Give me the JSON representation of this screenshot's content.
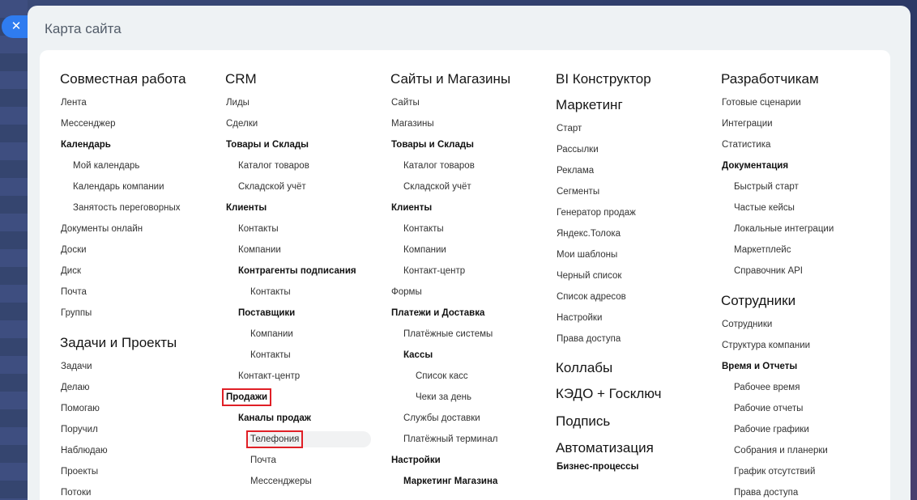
{
  "close_icon": "close-icon",
  "panel": {
    "title": "Карта сайта"
  },
  "columns": {
    "c1": {
      "sec1": "Совместная работа",
      "items1": [
        "Лента",
        "Мессенджер",
        "Календарь",
        "Мой календарь",
        "Календарь компании",
        "Занятость переговорных",
        "Документы онлайн",
        "Доски",
        "Диск",
        "Почта",
        "Группы"
      ],
      "sec2": "Задачи и Проекты",
      "items2": [
        "Задачи",
        "Делаю",
        "Помогаю",
        "Поручил",
        "Наблюдаю",
        "Проекты",
        "Потоки"
      ]
    },
    "c2": {
      "sec1": "CRM",
      "items": [
        "Лиды",
        "Сделки",
        "Товары и Склады",
        "Каталог товаров",
        "Складской учёт",
        "Клиенты",
        "Контакты",
        "Компании",
        "Контрагенты подписания",
        "Контакты",
        "Поставщики",
        "Компании",
        "Контакты",
        "Контакт-центр",
        "Продажи",
        "Каналы продаж",
        "Телефония",
        "Почта",
        "Мессенджеры"
      ]
    },
    "c3": {
      "sec1": "Сайты и Магазины",
      "items": [
        "Сайты",
        "Магазины",
        "Товары и Склады",
        "Каталог товаров",
        "Складской учёт",
        "Клиенты",
        "Контакты",
        "Компании",
        "Контакт-центр",
        "Формы",
        "Платежи и Доставка",
        "Платёжные системы",
        "Кассы",
        "Список касс",
        "Чеки за день",
        "Службы доставки",
        "Платёжный терминал",
        "Настройки",
        "Маркетинг Магазина"
      ]
    },
    "c4": {
      "sec1": "BI Конструктор",
      "sec2": "Маркетинг",
      "items": [
        "Старт",
        "Рассылки",
        "Реклама",
        "Сегменты",
        "Генератор продаж",
        "Яндекс.Толока",
        "Мои шаблоны",
        "Черный список",
        "Список адресов",
        "Настройки",
        "Права доступа"
      ],
      "sec3": "Коллабы",
      "sec4": "КЭДО + Госключ",
      "sec5": "Подпись",
      "sec6": "Автоматизация",
      "items2": [
        "Бизнес-процессы"
      ]
    },
    "c5": {
      "sec1": "Разработчикам",
      "items1": [
        "Готовые сценарии",
        "Интеграции",
        "Статистика",
        "Документация",
        "Быстрый старт",
        "Частые кейсы",
        "Локальные интеграции",
        "Маркетплейс",
        "Справочник API"
      ],
      "sec2": "Сотрудники",
      "items2": [
        "Сотрудники",
        "Структура компании",
        "Время и Отчеты",
        "Рабочее время",
        "Рабочие отчеты",
        "Рабочие графики",
        "Собрания и планерки",
        "График отсутствий",
        "Права доступа"
      ]
    }
  }
}
